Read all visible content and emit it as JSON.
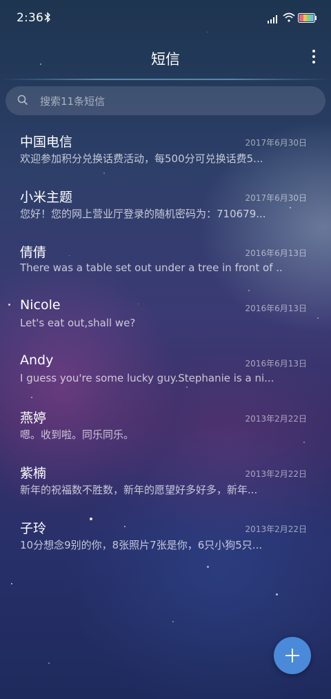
{
  "status_bar": {
    "time": "2:36",
    "icons": [
      "bluetooth-icon",
      "signal-icon",
      "wifi-icon",
      "battery-icon"
    ]
  },
  "header": {
    "title": "短信",
    "menu_icon": "more-vertical-icon"
  },
  "search": {
    "placeholder": "搜索11条短信",
    "icon": "search-icon"
  },
  "messages": [
    {
      "name": "中国电信",
      "date": "2017年6月30日",
      "preview": "欢迎参加积分兑换话费活动，每500分可兑换话费5..."
    },
    {
      "name": "小米主题",
      "date": "2017年6月30日",
      "preview": "您好！您的网上营业厅登录的随机密码为：710679..."
    },
    {
      "name": "倩倩",
      "date": "2016年6月13日",
      "preview": "There was a table set out under a tree in front of ..."
    },
    {
      "name": "Nicole",
      "date": "2016年6月13日",
      "preview": "Let's eat out,shall we?"
    },
    {
      "name": "Andy",
      "date": "2016年6月13日",
      "preview": "I guess you're some lucky guy.Stephanie is a ni..."
    },
    {
      "name": "燕婷",
      "date": "2013年2月22日",
      "preview": "嗯。收到啦。同乐同乐。"
    },
    {
      "name": "紫楠",
      "date": "2013年2月22日",
      "preview": "新年的祝福数不胜数，新年的愿望好多好多，新年..."
    },
    {
      "name": "子玲",
      "date": "2013年2月22日",
      "preview": "10分想念9别的你，8张照片7张是你，6只小狗5只..."
    }
  ],
  "compose": {
    "icon": "plus-icon",
    "color": "#4a8ad8"
  },
  "colors": {
    "accent": "#4a8ad8",
    "battery_fill": "#e86a7a"
  }
}
